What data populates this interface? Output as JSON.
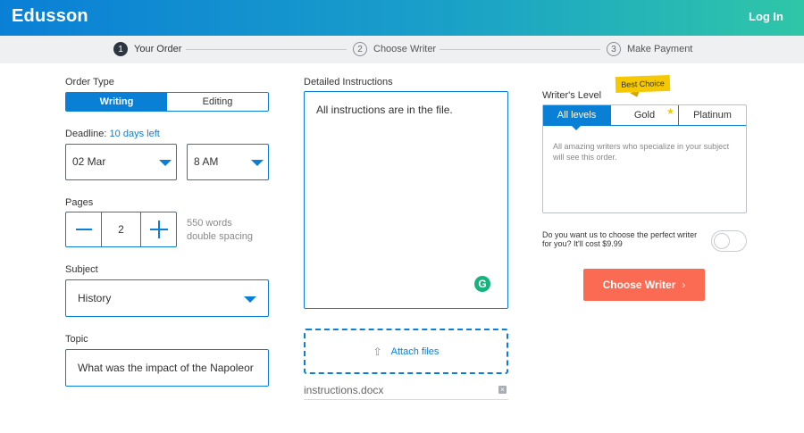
{
  "header": {
    "logo": "Edusson",
    "login": "Log In"
  },
  "steps": [
    {
      "num": "1",
      "label": "Your Order",
      "active": true
    },
    {
      "num": "2",
      "label": "Choose Writer",
      "active": false
    },
    {
      "num": "3",
      "label": "Make Payment",
      "active": false
    }
  ],
  "order_type": {
    "label": "Order Type",
    "options": [
      "Writing",
      "Editing"
    ],
    "selected": "Writing"
  },
  "deadline": {
    "label": "Deadline:",
    "left": "10 days left",
    "date": "02 Mar",
    "time": "8 AM"
  },
  "pages": {
    "label": "Pages",
    "value": "2",
    "words": "550 words",
    "spacing": "double spacing"
  },
  "subject": {
    "label": "Subject",
    "value": "History"
  },
  "topic": {
    "label": "Topic",
    "value": "What was the impact of the Napoleor"
  },
  "instructions": {
    "label": "Detailed Instructions",
    "value": "All instructions are in the file.",
    "grammarly_glyph": "G"
  },
  "attach": {
    "icon": "upload-icon",
    "label": "Attach files",
    "icon_glyph": "⇧"
  },
  "file": {
    "name": "instructions.docx",
    "remove_glyph": "×"
  },
  "writer_level": {
    "label": "Writer's Level",
    "badge": "Best Choice",
    "options": [
      "All levels",
      "Gold",
      "Platinum"
    ],
    "selected": "All levels",
    "star_glyph": "★",
    "description": "All amazing writers who specialize in your subject will see this order."
  },
  "perfect_writer": {
    "question": "Do you want us to choose the perfect writer for you? It'll cost $9.99",
    "enabled": false
  },
  "choose_button": {
    "label": "Choose Writer",
    "chevron": "›"
  },
  "colors": {
    "accent": "#0a7fd6",
    "cta": "#fb6b53",
    "badge": "#f5c800",
    "grammarly": "#15b47d"
  }
}
